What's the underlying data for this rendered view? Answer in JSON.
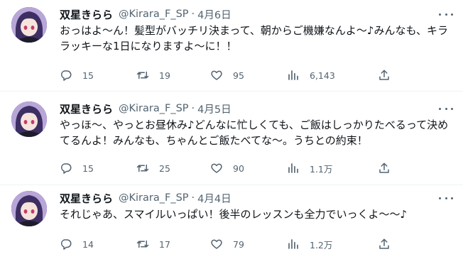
{
  "tweets": [
    {
      "name": "双星きらら",
      "handle": "@Kirara_F_SP",
      "separator": "·",
      "date": "4月6日",
      "text": "おっはよ〜ん！髪型がバッチリ決まって、朝からご機嫌なんよ〜♪みんなも、キララッキーな1日になりますよ〜に！！",
      "replies": "15",
      "retweets": "19",
      "likes": "95",
      "views": "6,143"
    },
    {
      "name": "双星きらら",
      "handle": "@Kirara_F_SP",
      "separator": "·",
      "date": "4月5日",
      "text": "やっほ〜、やっとお昼休み♪どんなに忙しくても、ご飯はしっかりたべるって決めてるんよ！みんなも、ちゃんとご飯たべてな〜。うちとの約束！",
      "replies": "15",
      "retweets": "25",
      "likes": "90",
      "views": "1.1万"
    },
    {
      "name": "双星きらら",
      "handle": "@Kirara_F_SP",
      "separator": "·",
      "date": "4月4日",
      "text": "それじゃあ、スマイルいっぱい！後半のレッスンも全力でいっくよ〜〜♪",
      "replies": "14",
      "retweets": "17",
      "likes": "79",
      "views": "1.2万"
    }
  ],
  "icons": {
    "reply": "reply-icon",
    "retweet": "retweet-icon",
    "like": "heart-icon",
    "views": "views-icon",
    "share": "share-icon",
    "more": "more-icon"
  },
  "colors": {
    "text": "#0f1419",
    "secondary": "#536471",
    "divider": "#eff3f4"
  }
}
